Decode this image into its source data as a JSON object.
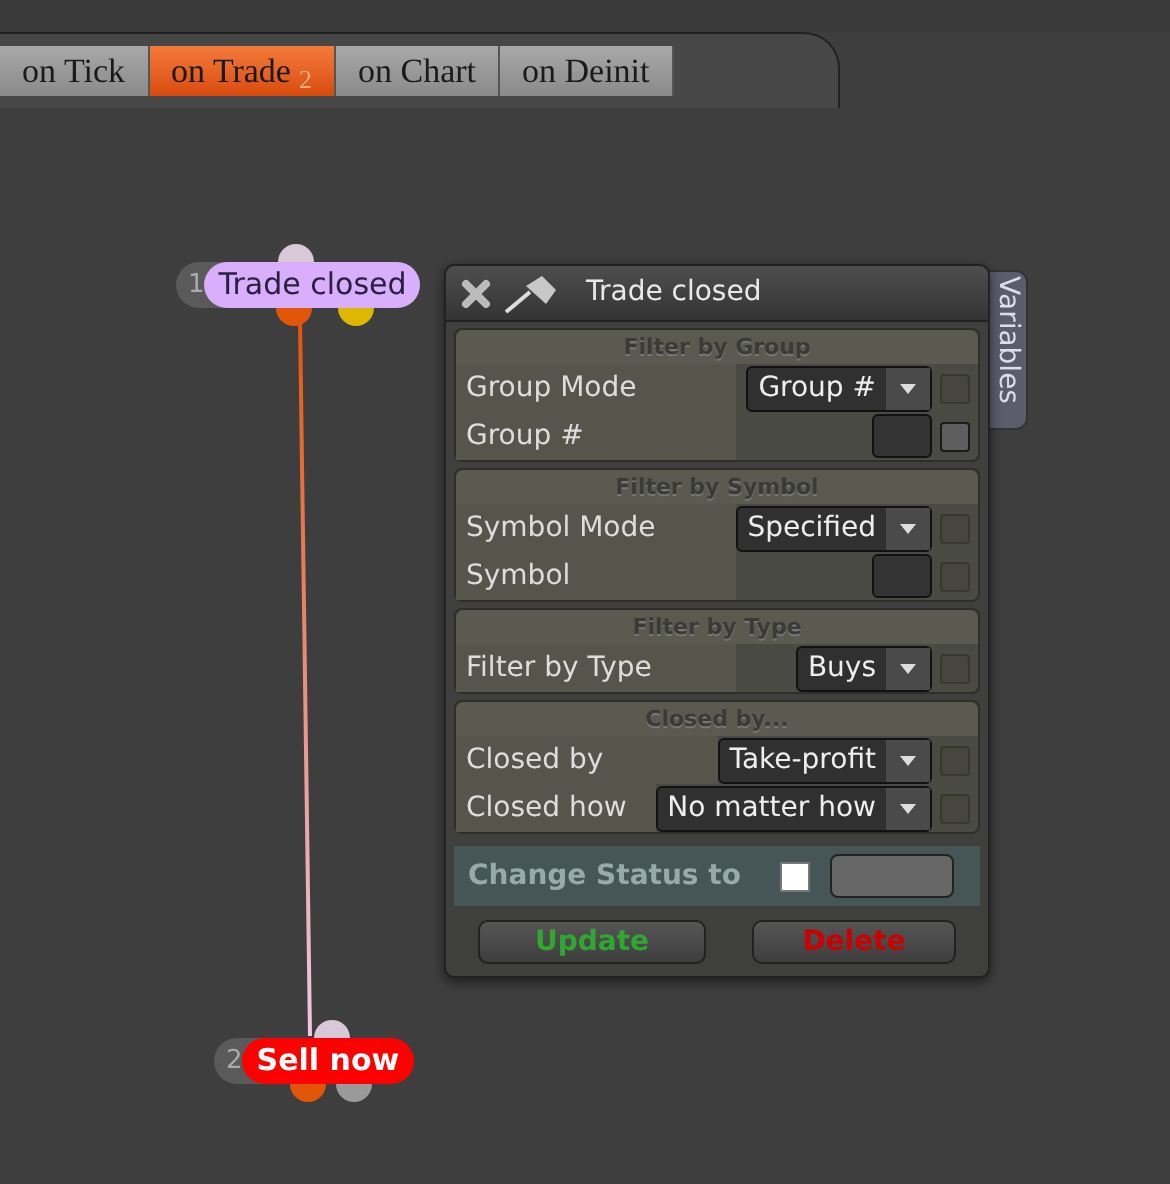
{
  "tabs": [
    {
      "label": "on Tick",
      "selected": false
    },
    {
      "label": "on Trade",
      "badge": "2",
      "selected": true
    },
    {
      "label": "on Chart",
      "selected": false
    },
    {
      "label": "on Deinit",
      "selected": false
    }
  ],
  "nodes": [
    {
      "number": "1",
      "label": "Trade closed",
      "color": "#d9aefc",
      "kind": "event",
      "outputs": [
        {
          "color": "#e2560a"
        },
        {
          "color": "#dcb800"
        }
      ]
    },
    {
      "number": "2",
      "label": "Sell now",
      "color": "#ff0000",
      "kind": "action",
      "outputs": [
        {
          "color": "#e2560a"
        },
        {
          "color": "#9a9a9a"
        }
      ]
    }
  ],
  "panel": {
    "title": "Trade closed",
    "side_tab": "Variables",
    "sections": [
      {
        "title": "Filter by Group",
        "rows": [
          {
            "label": "Group Mode",
            "kind": "dropdown",
            "value": "Group #",
            "check_enabled": false
          },
          {
            "label": "Group #",
            "kind": "input",
            "check_enabled": true
          }
        ]
      },
      {
        "title": "Filter by Symbol",
        "rows": [
          {
            "label": "Symbol Mode",
            "kind": "dropdown",
            "value": "Specified",
            "check_enabled": false
          },
          {
            "label": "Symbol",
            "kind": "input",
            "check_enabled": false
          }
        ]
      },
      {
        "title": "Filter by Type",
        "rows": [
          {
            "label": "Filter by Type",
            "kind": "dropdown",
            "value": "Buys",
            "check_enabled": false
          }
        ]
      },
      {
        "title": "Closed by...",
        "rows": [
          {
            "label": "Closed by",
            "kind": "dropdown",
            "value": "Take-profit",
            "check_enabled": false
          },
          {
            "label": "Closed how",
            "kind": "dropdown",
            "value": "No matter how",
            "check_enabled": false
          }
        ]
      }
    ],
    "status": {
      "label": "Change Status to",
      "checked": false
    },
    "buttons": [
      {
        "label": "Update",
        "kind": "update"
      },
      {
        "label": "Delete",
        "kind": "delete"
      }
    ]
  }
}
